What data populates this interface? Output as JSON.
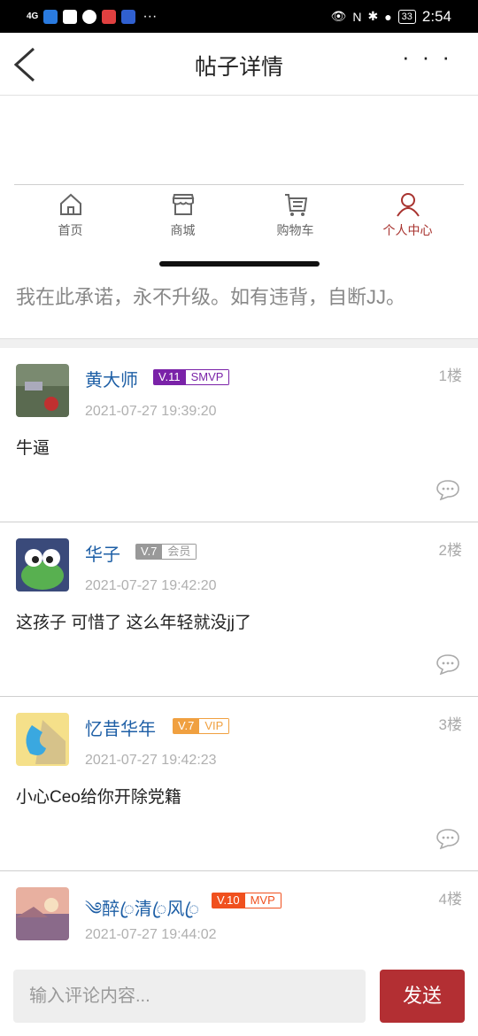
{
  "status_bar": {
    "signal": "4G",
    "dots": "···",
    "battery": "33",
    "time": "2:54"
  },
  "header": {
    "title": "帖子详情",
    "more": "···"
  },
  "nav_tabs": [
    {
      "label": "首页",
      "icon": "home-icon",
      "active": false
    },
    {
      "label": "商城",
      "icon": "store-icon",
      "active": false
    },
    {
      "label": "购物车",
      "icon": "cart-icon",
      "active": false
    },
    {
      "label": "个人中心",
      "icon": "user-icon",
      "active": true
    }
  ],
  "post": {
    "text": "我在此承诺，永不升级。如有违背，自断JJ。"
  },
  "comments": [
    {
      "name": "黄大师",
      "level": "V.11",
      "title": "SMVP",
      "badge_color": "#7a22a8",
      "floor": "1楼",
      "time": "2021-07-27 19:39:20",
      "content": "牛逼"
    },
    {
      "name": "华子",
      "level": "V.7",
      "title": "会员",
      "badge_color": "#999999",
      "floor": "2楼",
      "time": "2021-07-27 19:42:20",
      "content": "这孩子 可惜了 这么年轻就没jj了"
    },
    {
      "name": "忆昔华年",
      "level": "V.7",
      "title": "VIP",
      "badge_color": "#f0a040",
      "floor": "3楼",
      "time": "2021-07-27 19:42:23",
      "content": "小心Ceo给你开除党籍"
    },
    {
      "name": "༄醉ꦿ清ꦿ风ꦿ",
      "level": "V.10",
      "title": "MVP",
      "badge_color": "#f0501e",
      "floor": "4楼",
      "time": "2021-07-27 19:44:02",
      "content": ""
    }
  ],
  "comment_input": {
    "placeholder": "输入评论内容..."
  },
  "send_button": {
    "label": "发送"
  },
  "colors": {
    "accent": "#b32f33",
    "username": "#1e5fa6"
  }
}
